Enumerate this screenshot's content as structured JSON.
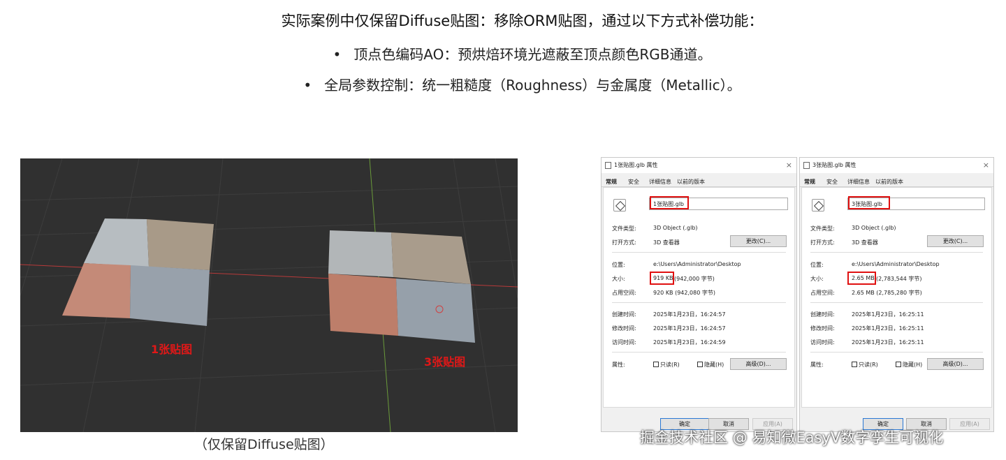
{
  "slide": {
    "heading": "实际案例中仅保留Diffuse贴图：移除ORM贴图，通过以下方式补偿功能：",
    "bullets": [
      "顶点色编码AO：预烘焙环境光遮蔽至顶点颜色RGB通道。",
      "全局参数控制：统一粗糙度（Roughness）与金属度（Metallic）。"
    ],
    "caption": "（仅保留Diffuse贴图）"
  },
  "viewport": {
    "label_left": "1张贴图",
    "label_right": "3张贴图",
    "label_color": "#e01818",
    "background": "#303030"
  },
  "windows": [
    {
      "title": "1张贴图.glb 属性",
      "close": "×",
      "tabs": [
        "常规",
        "安全",
        "详细信息",
        "以前的版本"
      ],
      "filename": "1张贴图.glb",
      "type_label": "文件类型:",
      "type_value": "3D Object (.glb)",
      "open_label": "打开方式:",
      "open_value": "3D 查看器",
      "change_button": "更改(C)...",
      "location_label": "位置:",
      "location_value": "e:\\Users\\Administrator\\Desktop",
      "size_label": "大小:",
      "size_value": "919 KB",
      "size_bytes": "(942,000 字节)",
      "disk_label": "占用空间:",
      "disk_value": "920 KB (942,080 字节)",
      "created_label": "创建时间:",
      "created_value": "2025年1月23日，16:24:57",
      "modified_label": "修改时间:",
      "modified_value": "2025年1月23日，16:24:57",
      "accessed_label": "访问时间:",
      "accessed_value": "2025年1月23日，16:24:59",
      "attr_label": "属性:",
      "readonly": "只读(R)",
      "hidden": "隐藏(H)",
      "advanced_button": "高级(D)...",
      "ok_button": "确定",
      "cancel_button": "取消",
      "apply_button": "应用(A)"
    },
    {
      "title": "3张贴图.glb 属性",
      "close": "×",
      "tabs": [
        "常规",
        "安全",
        "详细信息",
        "以前的版本"
      ],
      "filename": "3张贴图.glb",
      "type_label": "文件类型:",
      "type_value": "3D Object (.glb)",
      "open_label": "打开方式:",
      "open_value": "3D 查看器",
      "change_button": "更改(C)...",
      "location_label": "位置:",
      "location_value": "e:\\Users\\Administrator\\Desktop",
      "size_label": "大小:",
      "size_value": "2.65 MB",
      "size_bytes": "(2,783,544 字节)",
      "disk_label": "占用空间:",
      "disk_value": "2.65 MB (2,785,280 字节)",
      "created_label": "创建时间:",
      "created_value": "2025年1月23日，16:25:11",
      "modified_label": "修改时间:",
      "modified_value": "2025年1月23日，16:25:11",
      "accessed_label": "访问时间:",
      "accessed_value": "2025年1月23日，16:25:11",
      "attr_label": "属性:",
      "readonly": "只读(R)",
      "hidden": "隐藏(H)",
      "advanced_button": "高级(D)...",
      "ok_button": "确定",
      "cancel_button": "取消",
      "apply_button": "应用(A)"
    }
  ],
  "watermark": "掘金技术社区 @ 易知微EasyV数字孪生可视化",
  "colors": {
    "highlight_red": "#e01010",
    "axis_red": "#b83a3a",
    "axis_green": "#6a9a3a"
  }
}
